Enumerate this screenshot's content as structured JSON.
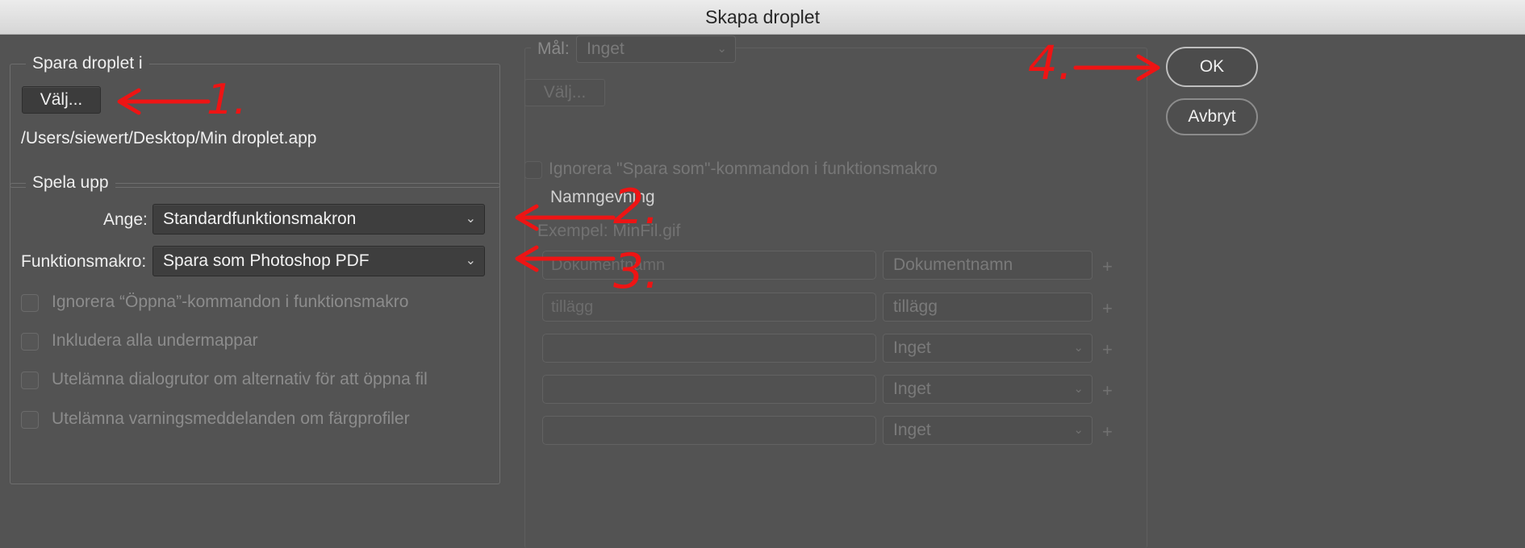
{
  "window": {
    "title": "Skapa droplet"
  },
  "save_group": {
    "legend": "Spara droplet i",
    "choose_button": "Välj...",
    "path": "/Users/siewert/Desktop/Min droplet.app"
  },
  "play_group": {
    "legend": "Spela upp",
    "set_label": "Ange:",
    "set_value": "Standardfunktionsmakron",
    "action_label": "Funktionsmakro:",
    "action_value": "Spara som Photoshop PDF",
    "checkboxes": [
      {
        "label": "Ignorera “Öppna”-kommandon i funktionsmakro",
        "checked": false
      },
      {
        "label": "Inkludera alla undermappar",
        "checked": false
      },
      {
        "label": "Utelämna dialogrutor om alternativ för att öppna fil",
        "checked": false
      },
      {
        "label": "Utelämna varningsmeddelanden om färgprofiler",
        "checked": false
      }
    ]
  },
  "destination": {
    "label": "Mål:",
    "value": "Inget",
    "choose_button": "Välj...",
    "override_checkbox": "Ignorera \"Spara som\"-kommandon i funktionsmakro",
    "naming_label": "Namngevning",
    "example": "Exempel: MinFil.gif",
    "rows": [
      {
        "text": "Dokumentnamn",
        "select": "Dokumentnamn"
      },
      {
        "text": "tillägg",
        "select": "tillägg"
      },
      {
        "text": "",
        "select": "Inget"
      },
      {
        "text": "",
        "select": "Inget"
      },
      {
        "text": "",
        "select": "Inget"
      }
    ],
    "plus_symbol": "+"
  },
  "buttons": {
    "ok": "OK",
    "cancel": "Avbryt"
  },
  "annotations": [
    "1.",
    "2.",
    "3.",
    "4."
  ],
  "colors": {
    "annotation": "#ee1414",
    "background": "#535353"
  }
}
